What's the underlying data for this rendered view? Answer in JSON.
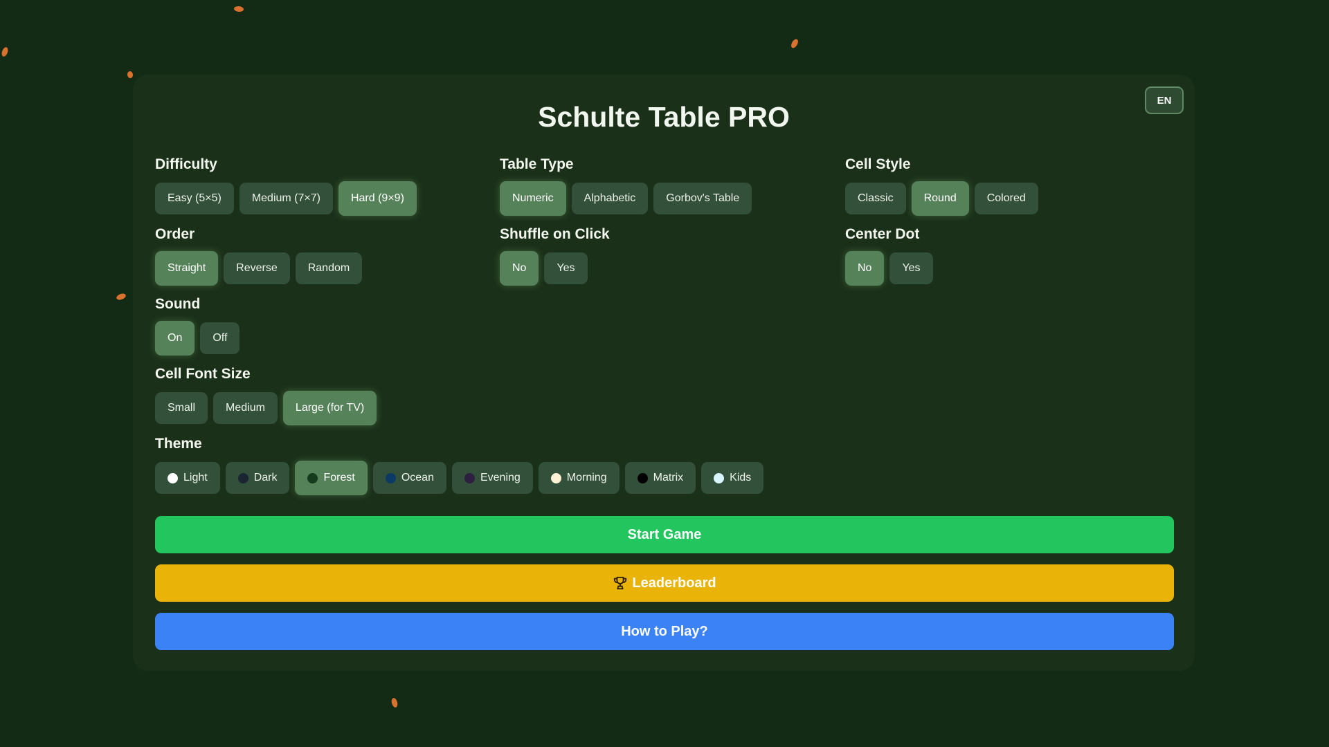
{
  "header": {
    "title": "Schulte Table PRO",
    "lang": "EN"
  },
  "sections": {
    "difficulty": {
      "label": "Difficulty",
      "options": [
        "Easy (5×5)",
        "Medium (7×7)",
        "Hard (9×9)"
      ],
      "selected": "Hard (9×9)"
    },
    "table_type": {
      "label": "Table Type",
      "options": [
        "Numeric",
        "Alphabetic",
        "Gorbov's Table"
      ],
      "selected": "Numeric"
    },
    "cell_style": {
      "label": "Cell Style",
      "options": [
        "Classic",
        "Round",
        "Colored"
      ],
      "selected": "Round"
    },
    "order": {
      "label": "Order",
      "options": [
        "Straight",
        "Reverse",
        "Random"
      ],
      "selected": "Straight"
    },
    "shuffle": {
      "label": "Shuffle on Click",
      "options": [
        "No",
        "Yes"
      ],
      "selected": "No"
    },
    "center_dot": {
      "label": "Center Dot",
      "options": [
        "No",
        "Yes"
      ],
      "selected": "No"
    },
    "sound": {
      "label": "Sound",
      "options": [
        "On",
        "Off"
      ],
      "selected": "On"
    },
    "font_size": {
      "label": "Cell Font Size",
      "options": [
        "Small",
        "Medium",
        "Large (for TV)"
      ],
      "selected": "Large (for TV)"
    },
    "theme": {
      "label": "Theme",
      "options": [
        "Light",
        "Dark",
        "Forest",
        "Ocean",
        "Evening",
        "Morning",
        "Matrix",
        "Kids"
      ],
      "dot_colors": [
        "#ffffff",
        "#1a2433",
        "#163a1c",
        "#0b3a66",
        "#2c1f3f",
        "#fff1d6",
        "#000000",
        "#d9f6ff"
      ],
      "selected": "Forest"
    }
  },
  "actions": {
    "start": "Start Game",
    "leaderboard": "Leaderboard",
    "help": "How to Play?"
  },
  "colors": {
    "start": "#22c55e",
    "leaderboard": "#eab308",
    "help": "#3b82f6",
    "leaf": "#d9722e"
  }
}
